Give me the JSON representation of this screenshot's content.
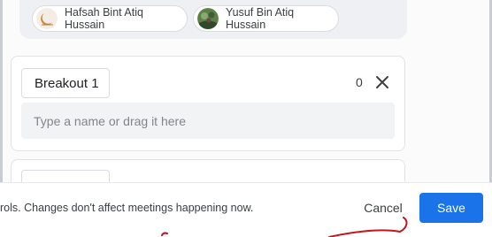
{
  "participants": [
    {
      "name": "Hafsah Bint Atiq Hussain",
      "avatar_icon": "crescent-moon-avatar-icon"
    },
    {
      "name": "Yusuf Bin Atiq Hussain",
      "avatar_icon": "photo-avatar-icon"
    }
  ],
  "breakout_rooms": [
    {
      "name": "Breakout 1",
      "participant_count": "0",
      "input_placeholder": "Type a name or drag it here"
    }
  ],
  "footer": {
    "note": "rols. Changes don't affect meetings happening now.",
    "cancel_label": "Cancel",
    "save_label": "Save"
  },
  "colors": {
    "accent": "#1a73e8",
    "annotation_ink": "#c4161c"
  }
}
